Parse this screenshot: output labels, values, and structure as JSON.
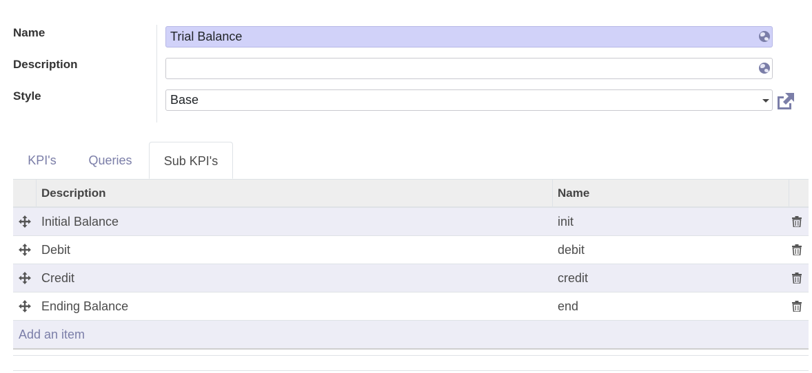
{
  "form": {
    "name_label": "Name",
    "name_value": "Trial Balance",
    "description_label": "Description",
    "description_value": "",
    "style_label": "Style",
    "style_value": "Base"
  },
  "tabs": [
    {
      "label": "KPI's"
    },
    {
      "label": "Queries"
    },
    {
      "label": "Sub KPI's"
    }
  ],
  "table": {
    "headers": {
      "description": "Description",
      "name": "Name"
    },
    "rows": [
      {
        "description": "Initial Balance",
        "name": "init"
      },
      {
        "description": "Debit",
        "name": "debit"
      },
      {
        "description": "Credit",
        "name": "credit"
      },
      {
        "description": "Ending Balance",
        "name": "end"
      }
    ],
    "add_item_label": "Add an item"
  },
  "colors": {
    "accent": "#7b7ea8",
    "highlight_field": "#d1d2f9",
    "row_stripe": "#ededf6"
  },
  "icons": {
    "translate": "globe-icon",
    "external": "external-link-icon",
    "drag": "move-handle-icon",
    "delete": "trash-icon"
  }
}
